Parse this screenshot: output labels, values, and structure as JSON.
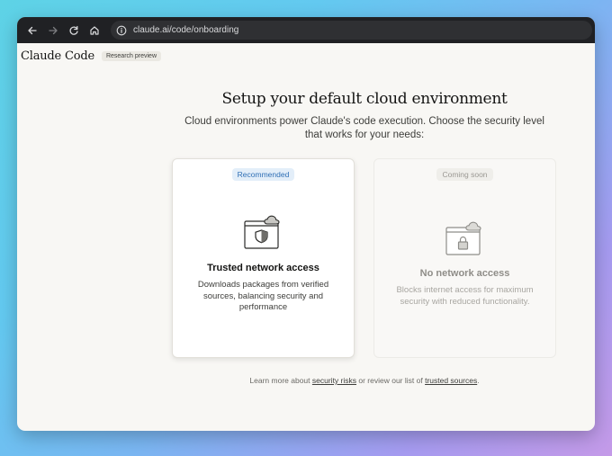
{
  "browser": {
    "url": "claude.ai/code/onboarding"
  },
  "app": {
    "brand": "Claude Code",
    "badge": "Research preview"
  },
  "page": {
    "title": "Setup your default cloud environment",
    "subtitle": "Cloud environments power Claude's code execution. Choose the security level that works for your needs:"
  },
  "cards": [
    {
      "tag": "Recommended",
      "title": "Trusted network access",
      "description": "Downloads packages from verified sources, balancing security and performance",
      "icon": "shield-cloud-window-icon"
    },
    {
      "tag": "Coming soon",
      "title": "No network access",
      "description": "Blocks internet access for maximum security with reduced functionality.",
      "icon": "lock-cloud-window-icon"
    }
  ],
  "footer": {
    "prefix": "Learn more about ",
    "link1": "security risks",
    "middle": " or review our list of ",
    "link2": "trusted sources",
    "suffix": "."
  },
  "colors": {
    "accent_blue": "#2f6fb5",
    "browser_chrome": "#202124",
    "page_bg": "#f8f7f4"
  }
}
